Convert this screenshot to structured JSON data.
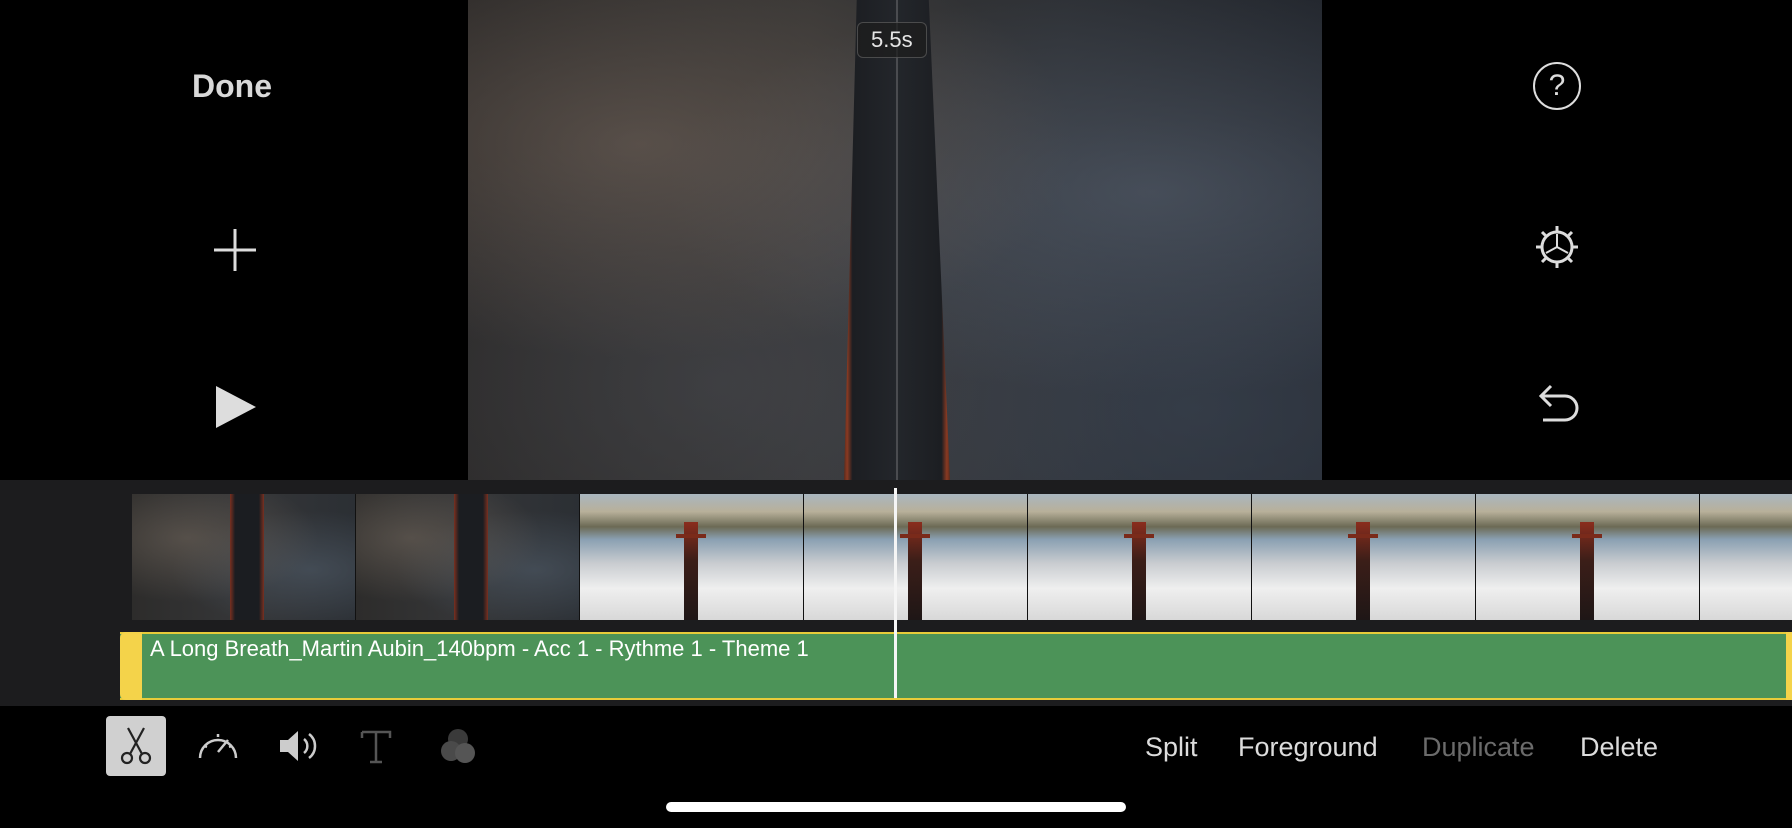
{
  "header": {
    "done_label": "Done"
  },
  "preview": {
    "time_badge": "5.5s"
  },
  "audio_clip": {
    "title": "A Long Breath_Martin Aubin_140bpm - Acc 1 - Rythme 1 - Theme 1"
  },
  "actions": {
    "split": "Split",
    "foreground": "Foreground",
    "duplicate": "Duplicate",
    "delete": "Delete"
  },
  "icons": {
    "left": [
      "plus-icon",
      "play-icon"
    ],
    "right": [
      "question-icon",
      "gear-icon",
      "undo-icon"
    ],
    "tools": [
      "scissors-icon",
      "speedometer-icon",
      "speaker-icon",
      "text-icon",
      "filters-icon"
    ]
  },
  "help_glyph": "?",
  "colors": {
    "audio_track": "#4c9358",
    "audio_handle": "#f4d34a",
    "tool_selected": "#d0d0d0",
    "disabled_text": "#6b6b6b"
  }
}
